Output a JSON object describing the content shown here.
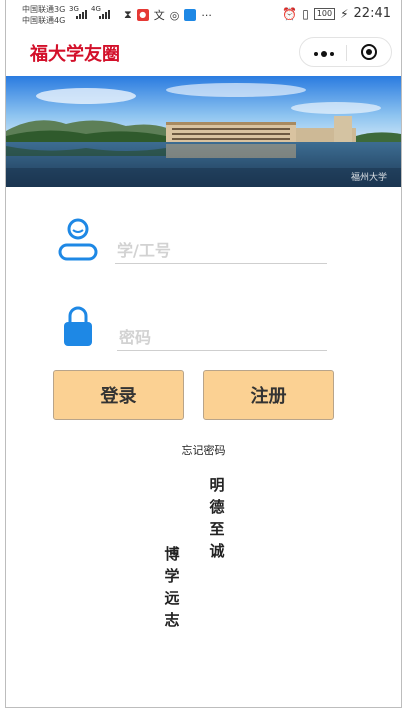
{
  "status_bar": {
    "carrier1": "中国联通3G",
    "carrier2": "中国联通4G",
    "net1": "3G",
    "net2": "4G",
    "more": "···",
    "battery": "100",
    "time": "22:41"
  },
  "nav": {
    "title": "福大学友圈"
  },
  "banner": {
    "watermark": "福州大学"
  },
  "form": {
    "username_placeholder": "学/工号",
    "password_placeholder": "密码",
    "login_label": "登录",
    "register_label": "注册",
    "forgot_label": "忘记密码"
  },
  "motto": {
    "line1": "明德至诚",
    "line2": "博学远志"
  },
  "colors": {
    "brand_red": "#d3102a",
    "button_fill": "#fbd193",
    "icon_blue": "#1e88e5"
  }
}
